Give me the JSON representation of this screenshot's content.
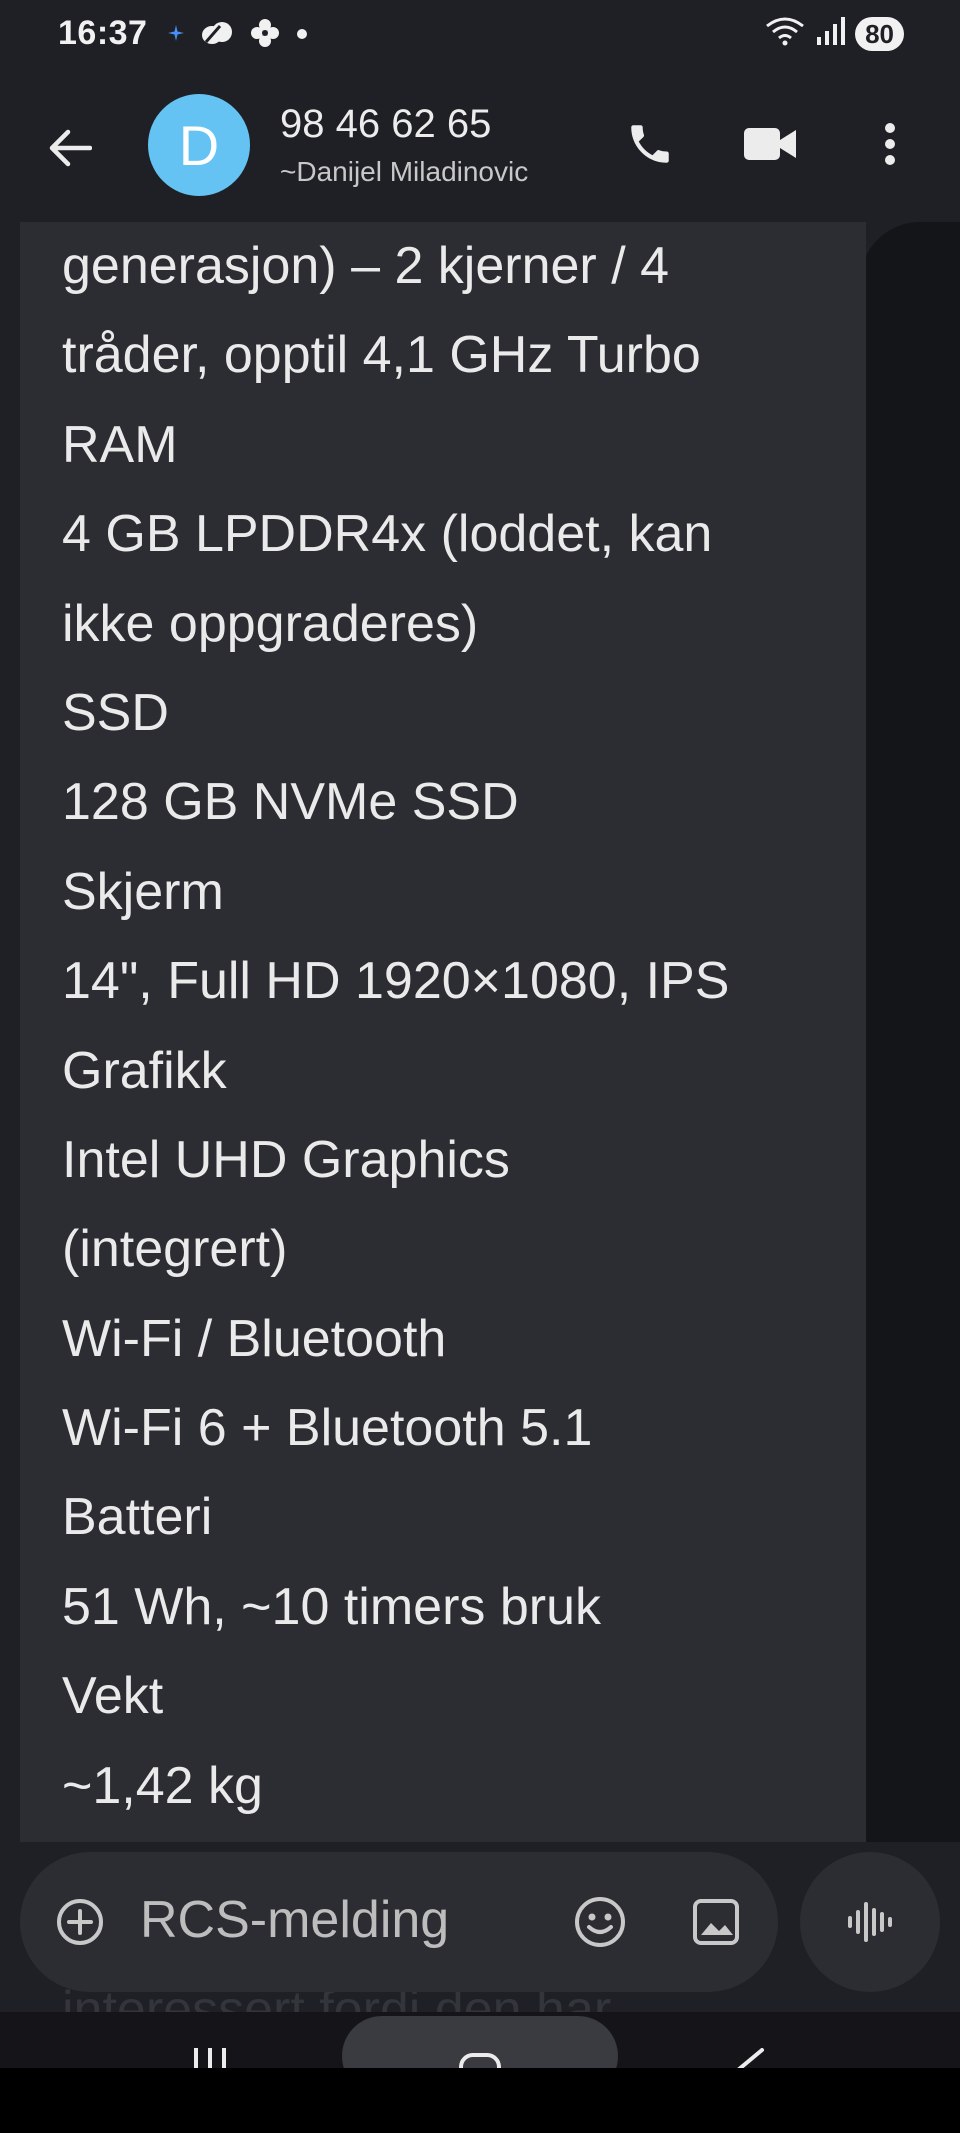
{
  "status_bar": {
    "time": "16:37",
    "battery_level": "80",
    "left_icons": [
      "sparkle-icon",
      "cloud-icon",
      "pinwheel-icon",
      "dot-icon"
    ],
    "right_icons": [
      "wifi-icon",
      "signal-icon"
    ]
  },
  "header": {
    "avatar_letter": "D",
    "avatar_color": "#64c3f2",
    "phone_number": "98 46 62 65",
    "contact_name": "~Danijel Miladinovic"
  },
  "message": {
    "lines": [
      "generasjon) – 2 kjerner / 4",
      "tråder, opptil 4,1 GHz Turbo",
      "RAM",
      "4 GB LPDDR4x (loddet, kan",
      "ikke oppgraderes)",
      "SSD",
      "128 GB NVMe SSD",
      "Skjerm",
      "14\", Full HD 1920×1080, IPS",
      "Grafikk",
      "Intel UHD Graphics",
      "(integrert)",
      "Wi-Fi / Bluetooth",
      "Wi-Fi 6 + Bluetooth 5.1",
      "Batteri",
      "51 Wh, ~10 timers bruk",
      "Vekt",
      "~1,42 kg"
    ]
  },
  "compose": {
    "placeholder": "RCS-melding",
    "peek_text": "interessert fordi den har"
  }
}
